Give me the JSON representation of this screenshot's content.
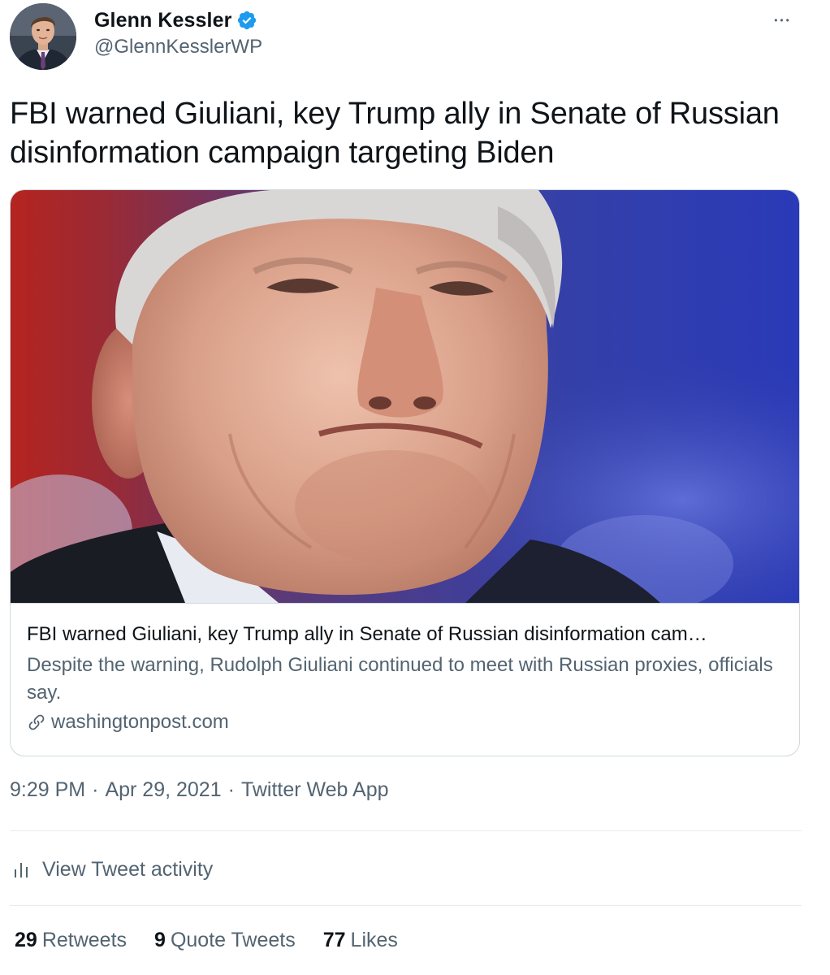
{
  "user": {
    "display_name": "Glenn Kessler",
    "handle": "@GlennKesslerWP",
    "verified": true
  },
  "menu": {
    "more_icon": "more-horizontal-icon",
    "more_glyph": "•••"
  },
  "tweet": {
    "text": "FBI warned Giuliani, key Trump ally in Senate of Russian disinformation campaign targeting Biden"
  },
  "card": {
    "title": "FBI warned Giuliani, key Trump ally in Senate of Russian disinformation cam…",
    "description": "Despite the warning, Rudolph Giuliani continued to meet with Russian proxies, officials say.",
    "domain": "washingtonpost.com",
    "domain_icon": "link-icon"
  },
  "meta": {
    "time": "9:29 PM",
    "separator": "·",
    "date": "Apr 29, 2021",
    "source": "Twitter Web App"
  },
  "activity": {
    "label": "View Tweet activity",
    "icon": "bar-chart-icon"
  },
  "stats": {
    "retweets_count": "29",
    "retweets_label": "Retweets",
    "quote_count": "9",
    "quote_label": "Quote Tweets",
    "likes_count": "77",
    "likes_label": "Likes"
  },
  "colors": {
    "primary_text": "#0f1419",
    "secondary_text": "#536471",
    "verified_blue": "#1d9bf0",
    "border": "#cfd9de"
  }
}
